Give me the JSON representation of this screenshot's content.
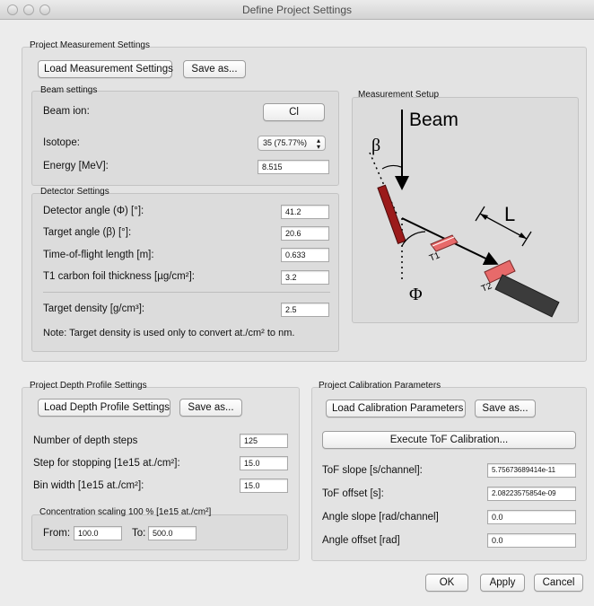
{
  "window": {
    "title": "Define Project Settings"
  },
  "measurement": {
    "group_title": "Project Measurement Settings",
    "load_button": "Load Measurement Settings",
    "save_button": "Save as...",
    "beam": {
      "group_title": "Beam settings",
      "ion_label": "Beam ion:",
      "ion_value": "Cl",
      "isotope_label": "Isotope:",
      "isotope_value": "35 (75.77%)",
      "energy_label": "Energy [MeV]:",
      "energy_value": "8.515"
    },
    "detector": {
      "group_title": "Detector Settings",
      "detector_angle_label": "Detector angle (Φ) [°]:",
      "detector_angle_value": "41.2",
      "target_angle_label": "Target angle (β) [°]:",
      "target_angle_value": "20.6",
      "tof_length_label": "Time-of-flight length [m]:",
      "tof_length_value": "0.633",
      "foil_label": "T1 carbon foil thickness [µg/cm²]:",
      "foil_value": "3.2",
      "density_label": "Target density [g/cm³]:",
      "density_value": "2.5",
      "note": "Note: Target density is used only to convert at./cm² to nm."
    },
    "setup": {
      "group_title": "Measurement Setup",
      "beam_label": "Beam",
      "beta_label": "β",
      "phi_label": "Φ",
      "length_label": "L",
      "t1_label": "T1",
      "t2_label": "T2"
    }
  },
  "depth": {
    "group_title": "Project Depth Profile Settings",
    "load_button": "Load Depth Profile Settings",
    "save_button": "Save as...",
    "steps_label": "Number of depth steps",
    "steps_value": "125",
    "stopping_label": "Step for stopping [1e15 at./cm²]:",
    "stopping_value": "15.0",
    "bin_label": "Bin width [1e15 at./cm²]:",
    "bin_value": "15.0",
    "conc": {
      "group_title": "Concentration scaling 100 % [1e15 at./cm²]",
      "from_label": "From:",
      "from_value": "100.0",
      "to_label": "To:",
      "to_value": "500.0"
    }
  },
  "calibration": {
    "group_title": "Project Calibration Parameters",
    "load_button": "Load Calibration Parameters",
    "save_button": "Save as...",
    "execute_button": "Execute ToF Calibration...",
    "tof_slope_label": "ToF slope [s/channel]:",
    "tof_slope_value": "5.75673689414e-11",
    "tof_offset_label": "ToF offset [s]:",
    "tof_offset_value": "2.08223575854e-09",
    "angle_slope_label": "Angle slope [rad/channel]",
    "angle_slope_value": "0.0",
    "angle_offset_label": "Angle offset [rad]",
    "angle_offset_value": "0.0"
  },
  "footer": {
    "ok": "OK",
    "apply": "Apply",
    "cancel": "Cancel"
  }
}
